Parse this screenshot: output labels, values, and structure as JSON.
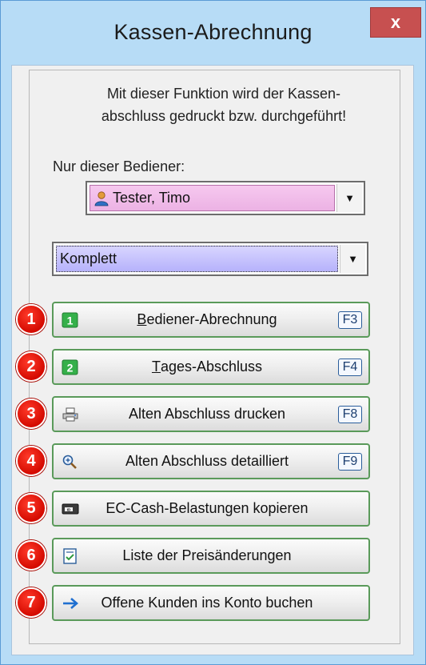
{
  "window": {
    "title": "Kassen-Abrechnung",
    "close_glyph": "x"
  },
  "description": {
    "line1": "Mit dieser Funktion wird der Kassen-",
    "line2": "abschluss gedruckt bzw. durchgeführt!"
  },
  "operator": {
    "label": "Nur dieser Bediener:",
    "selected": "Tester, Timo",
    "icon": "user-icon"
  },
  "mode": {
    "selected": "Komplett"
  },
  "buttons": [
    {
      "number": "1",
      "label": "Bediener-Abrechnung",
      "shortcut": "F3",
      "icon": "number-one-icon",
      "underline": "B"
    },
    {
      "number": "2",
      "label": "Tages-Abschluss",
      "shortcut": "F4",
      "icon": "number-two-icon",
      "underline": "T"
    },
    {
      "number": "3",
      "label": "Alten Abschluss drucken",
      "shortcut": "F8",
      "icon": "printer-icon"
    },
    {
      "number": "4",
      "label": "Alten Abschluss detailliert",
      "shortcut": "F9",
      "icon": "magnifier-icon"
    },
    {
      "number": "5",
      "label": "EC-Cash-Belastungen kopieren",
      "shortcut": "",
      "icon": "card-icon"
    },
    {
      "number": "6",
      "label": "Liste der Preisänderungen",
      "shortcut": "",
      "icon": "checklist-icon"
    },
    {
      "number": "7",
      "label": "Offene Kunden ins Konto buchen",
      "shortcut": "",
      "icon": "arrow-right-icon"
    }
  ],
  "colors": {
    "title_bar": "#b7dcf6",
    "close_button": "#c75050",
    "badge": "#d40a00",
    "button_border": "#5a9a5a",
    "operator_highlight": "#ecb2e4",
    "mode_highlight": "#b6b2fb"
  }
}
